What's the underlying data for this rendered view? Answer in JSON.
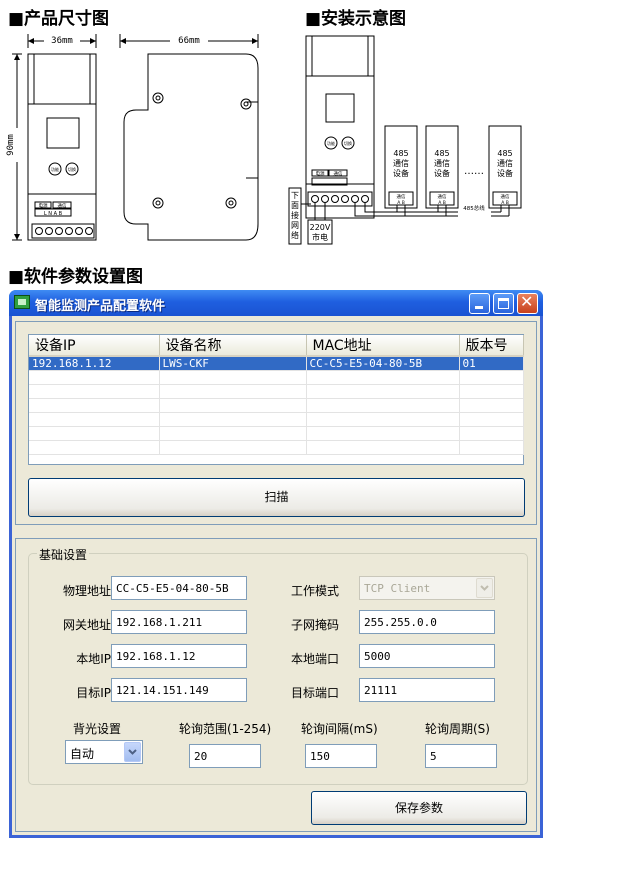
{
  "headings": {
    "dimensions": "■产品尺寸图",
    "installation": "■安装示意图",
    "software": "■软件参数设置图"
  },
  "dimension_diagram": {
    "width_front": "36mm",
    "width_side": "66mm",
    "height": "90mm",
    "btn_left": "功能",
    "btn_right": "切换",
    "label_power": "电源",
    "label_comm": "通信",
    "terminals": "L N A B"
  },
  "install_diagram": {
    "device_label": "485通信设备",
    "ellipsis": "……",
    "comm_label": "通信",
    "ab": "A B",
    "network": "下面接网络",
    "mains_220": "220V",
    "mains_label": "市电",
    "bus": "485总线",
    "label_power": "电源",
    "label_comm": "通信",
    "btn_left": "功能",
    "btn_right": "切换"
  },
  "window": {
    "title": "智能监测产品配置软件",
    "columns": [
      "设备IP",
      "设备名称",
      "MAC地址",
      "版本号"
    ],
    "rows": [
      [
        "192.168.1.12",
        "LWS-CKF",
        "CC-C5-E5-04-80-5B",
        "01"
      ]
    ],
    "scan_button": "扫描",
    "group_title": "基础设置",
    "fields": {
      "mac_label": "物理地址",
      "mac_value": "CC-C5-E5-04-80-5B",
      "mode_label": "工作模式",
      "mode_value": "TCP Client",
      "gateway_label": "网关地址",
      "gateway_value": "192.168.1.211",
      "mask_label": "子网掩码",
      "mask_value": "255.255.0.0",
      "local_ip_label": "本地IP",
      "local_ip_value": "192.168.1.12",
      "local_port_label": "本地端口",
      "local_port_value": "5000",
      "target_ip_label": "目标IP",
      "target_ip_value": "121.14.151.149",
      "target_port_label": "目标端口",
      "target_port_value": "21111",
      "backlight_label": "背光设置",
      "backlight_value": "自动",
      "poll_range_label": "轮询范围(1-254)",
      "poll_range_value": "20",
      "poll_interval_label": "轮询间隔(mS)",
      "poll_interval_value": "150",
      "poll_period_label": "轮询周期(S)",
      "poll_period_value": "5"
    },
    "save_button": "保存参数"
  },
  "colors": {
    "titlebar": "#1f5fe0",
    "selection": "#316ac5",
    "dialog_bg": "#ece9d8"
  }
}
